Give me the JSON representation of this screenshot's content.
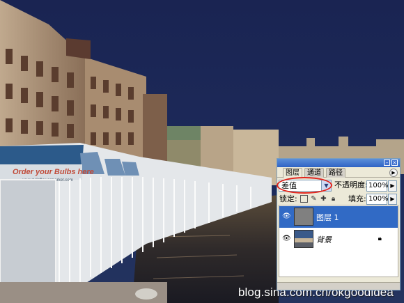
{
  "panel": {
    "tabs": [
      "图层",
      "通道",
      "路径"
    ],
    "menu_icon": "triangle-menu-icon",
    "blend_mode": "差值",
    "opacity_label": "不透明度:",
    "opacity_value": "100%",
    "lock_label": "锁定:",
    "lock_icons": [
      "lock-transparent-icon",
      "lock-image-icon",
      "lock-position-icon",
      "lock-all-icon"
    ],
    "fill_label": "填充:",
    "fill_value": "100%",
    "layers": [
      {
        "name": "图层 1",
        "visible": true,
        "selected": true
      },
      {
        "name": "背景",
        "visible": true,
        "selected": false,
        "locked": true
      }
    ]
  },
  "photo_text": {
    "shop_sign": "Order your Bulbs here",
    "shop_url": "www.tulipflowermarket.com"
  },
  "watermark": "blog.sina.com.cn/okgoodidea",
  "colors": {
    "sky": "#1a2550",
    "panel_bg": "#ece9d8",
    "selection": "#316ac5",
    "highlight_ring": "#e2231a"
  }
}
